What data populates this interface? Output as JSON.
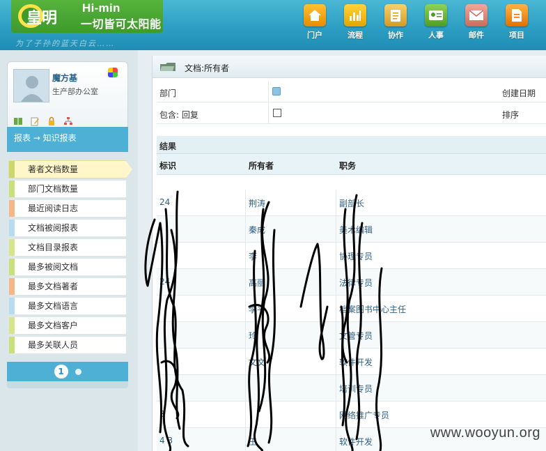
{
  "brand": {
    "logo_text": "皇明",
    "name": "Hi-min",
    "slogan": "一切皆可太阳能",
    "tagline": "为了子孙的蓝天白云……",
    "colors": {
      "header": "#2d9fc3",
      "logo_green": "#4aa832",
      "accent": "#4fb0d6"
    }
  },
  "topnav": [
    {
      "label": "门户",
      "icon": "home-icon"
    },
    {
      "label": "流程",
      "icon": "bar-chart-icon"
    },
    {
      "label": "协作",
      "icon": "clipboard-icon"
    },
    {
      "label": "人事",
      "icon": "id-card-icon"
    },
    {
      "label": "邮件",
      "icon": "mail-icon"
    },
    {
      "label": "项目",
      "icon": "document-icon"
    }
  ],
  "user": {
    "name": "魔方基",
    "dept": "生产部办公室"
  },
  "sidebar": {
    "breadcrumb": "报表 → 知识报表",
    "items": [
      {
        "label": "著者文档数量",
        "stripe": "#c9d86a",
        "active": true
      },
      {
        "label": "部门文档数量",
        "stripe": "#c9e07a"
      },
      {
        "label": "最近阅读日志",
        "stripe": "#f5b784"
      },
      {
        "label": "文档被阅报表",
        "stripe": "#b8dcef"
      },
      {
        "label": "文档目录报表",
        "stripe": "#d6e48a"
      },
      {
        "label": "最多被阅文档",
        "stripe": "#c8e07a"
      },
      {
        "label": "最多文档著者",
        "stripe": "#f5b784"
      },
      {
        "label": "最多文档语言",
        "stripe": "#b8dcef"
      },
      {
        "label": "最多文档客户",
        "stripe": "#d6e48a"
      },
      {
        "label": "最多关联人员",
        "stripe": "#c8e07a"
      }
    ],
    "pager": {
      "current": "1"
    }
  },
  "main": {
    "title": "文档:所有者",
    "form": {
      "dept_label": "部门",
      "created_label": "创建日期",
      "include_reply_label": "包含: 回复",
      "sort_label": "排序"
    },
    "results_label": "结果",
    "columns": [
      "标识",
      "所有者",
      "职务"
    ],
    "rows": [
      {
        "id": "24",
        "owner": "荆涛",
        "title": "副部长"
      },
      {
        "id": "",
        "owner": "秦成",
        "title": "美术编辑"
      },
      {
        "id": "",
        "owner": "李",
        "title": "协理专员"
      },
      {
        "id": "24",
        "owner": "高丽",
        "title": "法律专员"
      },
      {
        "id": "",
        "owner": "李平",
        "title": "档案图书中心主任"
      },
      {
        "id": "",
        "owner": "玲",
        "title": "文管专员"
      },
      {
        "id": "",
        "owner": "文文",
        "title": "软件开发"
      },
      {
        "id": "",
        "owner": "",
        "title": "培训专员"
      },
      {
        "id": "3",
        "owner": "",
        "title": "网络推广专员"
      },
      {
        "id": "4 3",
        "owner": "王",
        "title": "软件开发"
      }
    ]
  },
  "watermark": "www.wooyun.org"
}
